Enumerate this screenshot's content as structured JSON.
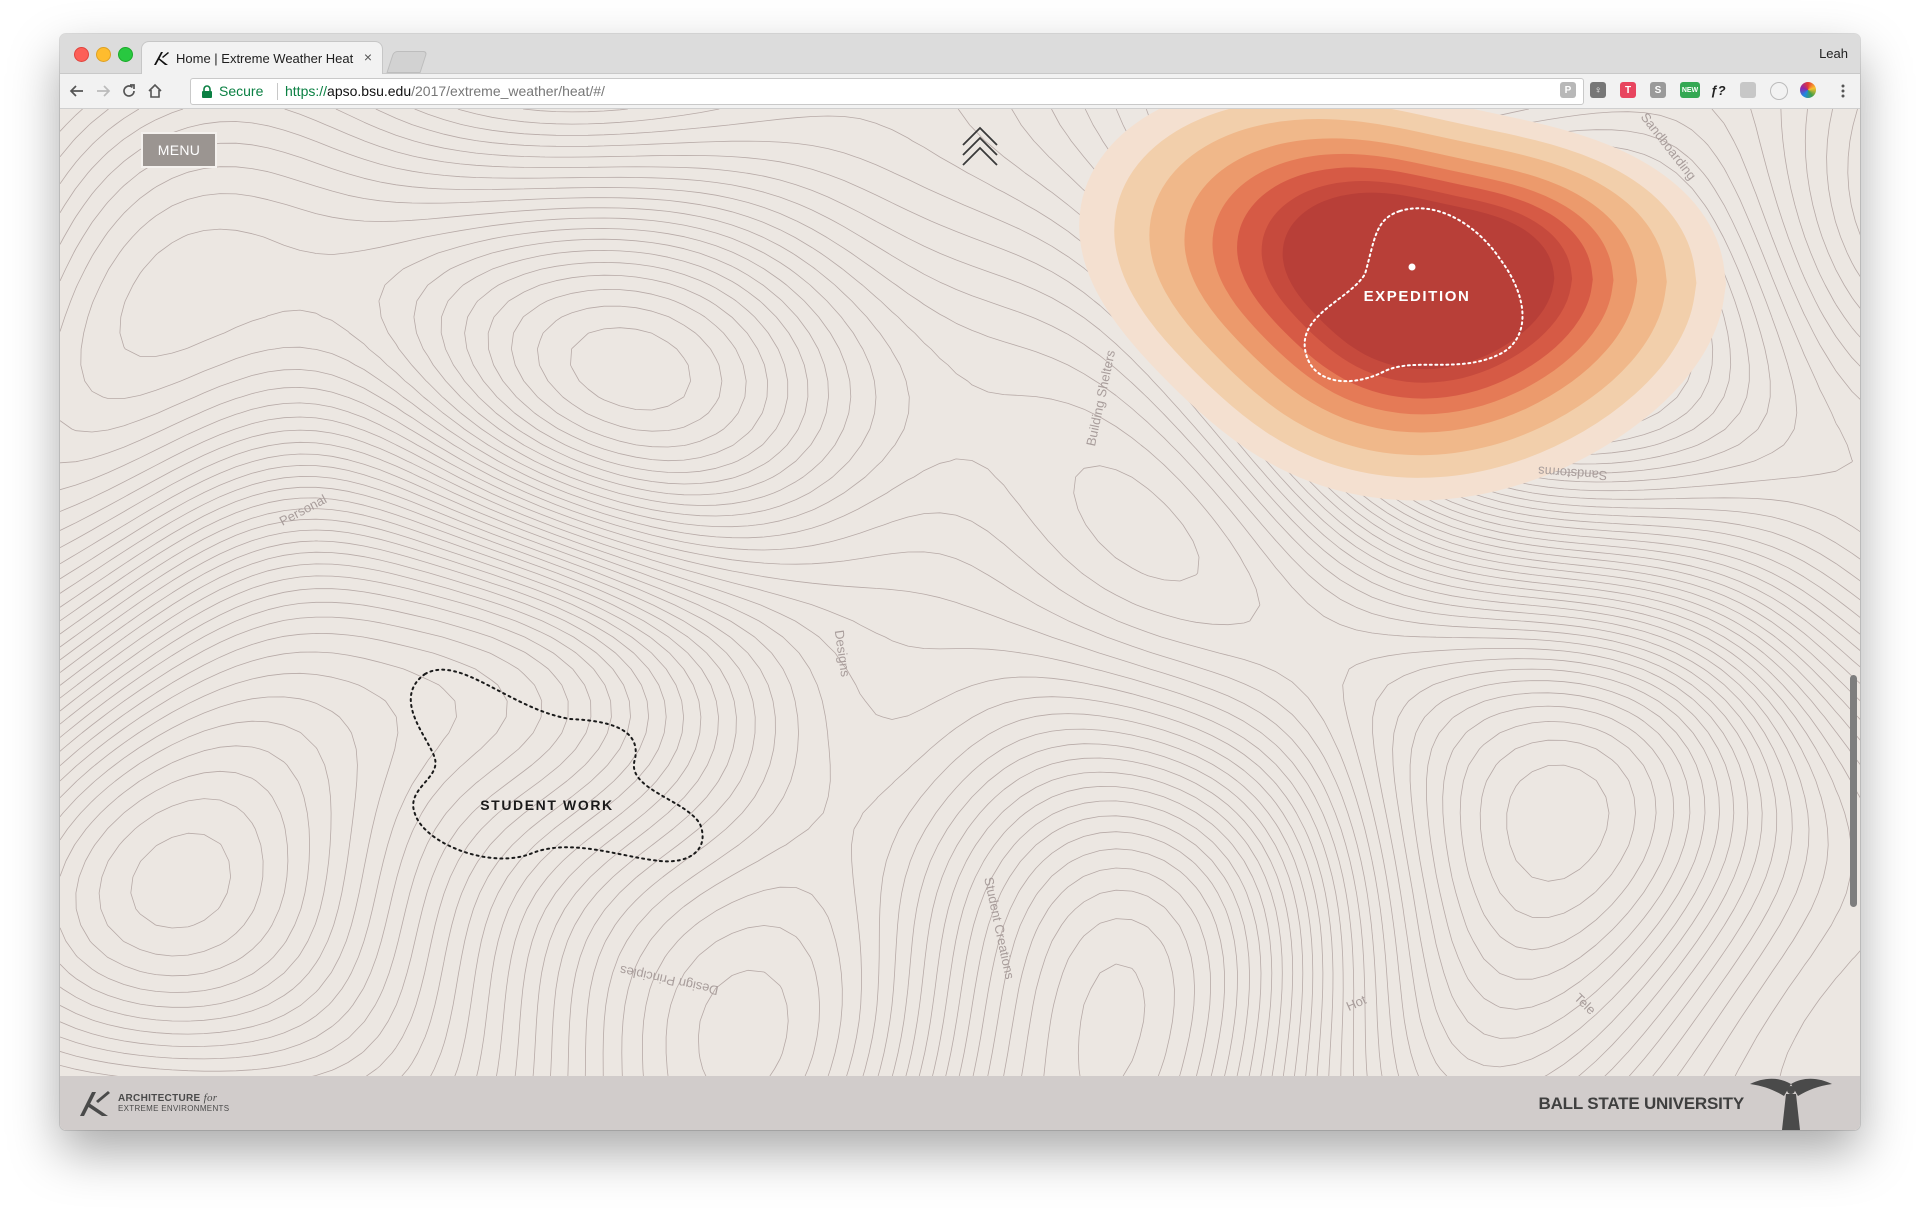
{
  "browser": {
    "tab_title": "Home | Extreme Weather Heat",
    "tab_close": "×",
    "profile_name": "Leah",
    "secure_label": "Secure",
    "url_scheme": "https://",
    "url_host": "apso.bsu.edu",
    "url_path": "/2017/extreme_weather/heat/#/",
    "extensions": [
      {
        "name": "extension-p-icon",
        "label": "P",
        "color": "#b8b8b8"
      },
      {
        "name": "extension-bulb-icon",
        "label": "♀",
        "color": "#777777"
      },
      {
        "name": "extension-t-icon",
        "label": "T",
        "color": "#e8455f"
      },
      {
        "name": "extension-s-icon",
        "label": "S",
        "color": "#9a9a9a"
      },
      {
        "name": "extension-new-icon",
        "label": "NEW",
        "color": "#34a853"
      },
      {
        "name": "extension-fx-icon",
        "label": "ƒ?",
        "color": "#333333"
      },
      {
        "name": "extension-box-icon",
        "label": "",
        "color": "#c7c7c7"
      },
      {
        "name": "extension-circle-icon",
        "label": "",
        "color": "#bdbdbd"
      },
      {
        "name": "extension-color-wheel-icon",
        "label": "",
        "color": "#e0582a"
      }
    ]
  },
  "page": {
    "menu_label": "MENU",
    "scroll_up_icon": "triple-chevron-up-icon",
    "regions": [
      {
        "id": "expedition",
        "label": "EXPEDITION"
      },
      {
        "id": "student-work",
        "label": "STUDENT WORK"
      }
    ],
    "contour_labels": [
      "Personal",
      "Building Shelters",
      "Sandboarding",
      "Sandstorms",
      "Designs",
      "Student Creations",
      "Design Principles",
      "Hot",
      "Tele"
    ],
    "heat_colors": [
      "#f4e0d0",
      "#f2cfab",
      "#f0b88a",
      "#ec9a6c",
      "#e57a56",
      "#d65a45",
      "#c64a3d",
      "#b83f38"
    ],
    "accent_color": "#b83f38",
    "background_color": "#ece7e2",
    "contour_color": "#b7aaa7"
  },
  "footer": {
    "logo_line1": "ARCHITECTURE",
    "logo_line1_suffix": "for",
    "logo_line2": "EXTREME ENVIRONMENTS",
    "university": "BALL STATE UNIVERSITY"
  }
}
